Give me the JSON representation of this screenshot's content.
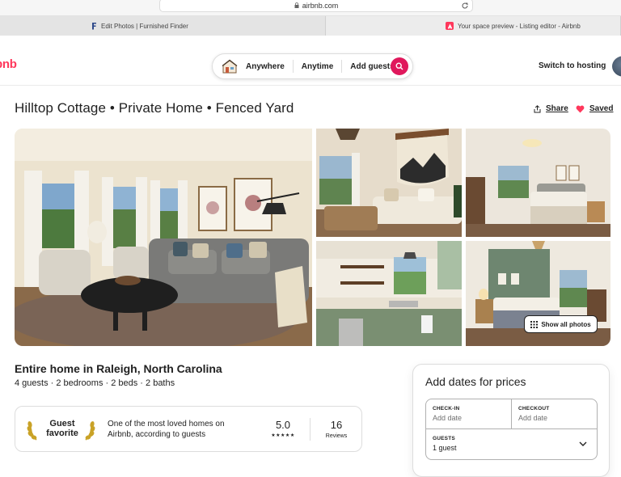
{
  "browser": {
    "url": "airbnb.com",
    "tabs": [
      {
        "label": "Edit Photos | Furnished Finder"
      },
      {
        "label": "Your space preview - Listing editor - Airbnb"
      }
    ]
  },
  "header": {
    "logo": "bnb",
    "search": {
      "where": "Anywhere",
      "when": "Anytime",
      "who": "Add guests"
    },
    "switch_hosting": "Switch to hosting"
  },
  "listing": {
    "title": "Hilltop Cottage • Private Home • Fenced Yard",
    "share": "Share",
    "saved": "Saved",
    "show_all_photos": "Show all photos",
    "subtitle": "Entire home in Raleigh, North Carolina",
    "details": "4 guests · 2 bedrooms · 2 beds · 2 baths"
  },
  "guest_favorite": {
    "badge_line1": "Guest",
    "badge_line2": "favorite",
    "description": "One of the most loved homes on Airbnb, according to guests",
    "rating": "5.0",
    "stars": "★★★★★",
    "reviews_count": "16",
    "reviews_label": "Reviews"
  },
  "booking": {
    "heading": "Add dates for prices",
    "checkin_label": "CHECK-IN",
    "checkin_value": "Add date",
    "checkout_label": "CHECKOUT",
    "checkout_value": "Add date",
    "guests_label": "GUESTS",
    "guests_value": "1 guest"
  },
  "colors": {
    "brand": "#ff385c",
    "search_button": "#e0185c",
    "text": "#222222"
  }
}
